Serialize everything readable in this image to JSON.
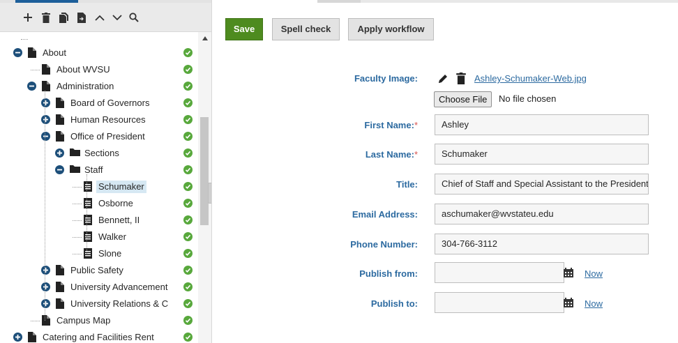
{
  "toolbar": {
    "icons": [
      "add-icon",
      "delete-icon",
      "copy-icon",
      "move-icon",
      "move-up-icon",
      "move-down-icon",
      "search-icon"
    ]
  },
  "tree": {
    "items": [
      {
        "label": "About",
        "icon": "page-icon",
        "toggle": "collapse",
        "status": "published"
      },
      {
        "label": "About WVSU",
        "icon": "page-icon",
        "toggle": "",
        "status": "published"
      },
      {
        "label": "Administration",
        "icon": "page-icon",
        "toggle": "collapse",
        "status": "published"
      },
      {
        "label": "Board of Governors",
        "icon": "page-icon",
        "toggle": "expand",
        "status": "published"
      },
      {
        "label": "Human Resources",
        "icon": "page-icon",
        "toggle": "expand",
        "status": "published"
      },
      {
        "label": "Office of President",
        "icon": "page-icon",
        "toggle": "collapse",
        "status": "published"
      },
      {
        "label": "Sections",
        "icon": "folder-icon",
        "toggle": "expand",
        "status": "published"
      },
      {
        "label": "Staff",
        "icon": "folder-icon",
        "toggle": "collapse",
        "status": "published"
      },
      {
        "label": "Schumaker",
        "icon": "document-icon",
        "toggle": "",
        "status": "published",
        "selected": true
      },
      {
        "label": "Osborne",
        "icon": "document-icon",
        "toggle": "",
        "status": "published"
      },
      {
        "label": "Bennett, II",
        "icon": "document-icon",
        "toggle": "",
        "status": "published"
      },
      {
        "label": "Walker",
        "icon": "document-icon",
        "toggle": "",
        "status": "published"
      },
      {
        "label": "Slone",
        "icon": "document-icon",
        "toggle": "",
        "status": "published"
      },
      {
        "label": "Public Safety",
        "icon": "page-icon",
        "toggle": "expand",
        "status": "published"
      },
      {
        "label": "University Advancement",
        "icon": "page-icon",
        "toggle": "expand",
        "status": "published"
      },
      {
        "label": "University Relations & C",
        "icon": "page-icon",
        "toggle": "expand",
        "status": "published"
      },
      {
        "label": "Campus Map",
        "icon": "page-icon",
        "toggle": "",
        "status": "published"
      },
      {
        "label": "Catering and Facilities Rent",
        "icon": "page-icon",
        "toggle": "expand",
        "status": "published"
      }
    ]
  },
  "actions": {
    "save": "Save",
    "spell_check": "Spell check",
    "apply_workflow": "Apply workflow"
  },
  "form": {
    "faculty_image": {
      "label": "Faculty Image:",
      "file_name": "Ashley-Schumaker-Web.jpg",
      "choose_file": "Choose File",
      "no_file": "No file chosen"
    },
    "first_name": {
      "label": "First Name:",
      "required": "*",
      "value": "Ashley"
    },
    "last_name": {
      "label": "Last Name:",
      "required": "*",
      "value": "Schumaker"
    },
    "title": {
      "label": "Title:",
      "value": "Chief of Staff and Special Assistant to the President"
    },
    "email": {
      "label": "Email Address:",
      "value": "aschumaker@wvstateu.edu"
    },
    "phone": {
      "label": "Phone Number:",
      "value": "304-766-3112"
    },
    "publish_from": {
      "label": "Publish from:",
      "value": "",
      "now": "Now"
    },
    "publish_to": {
      "label": "Publish to:",
      "value": "",
      "now": "Now"
    }
  },
  "colors": {
    "primary_button": "#4e8b1f",
    "label_blue": "#2c6aa0",
    "tree_toggle": "#1d4f7a",
    "status_green": "#58a83c",
    "selection": "#d6e8f3",
    "required": "#d9534f"
  }
}
